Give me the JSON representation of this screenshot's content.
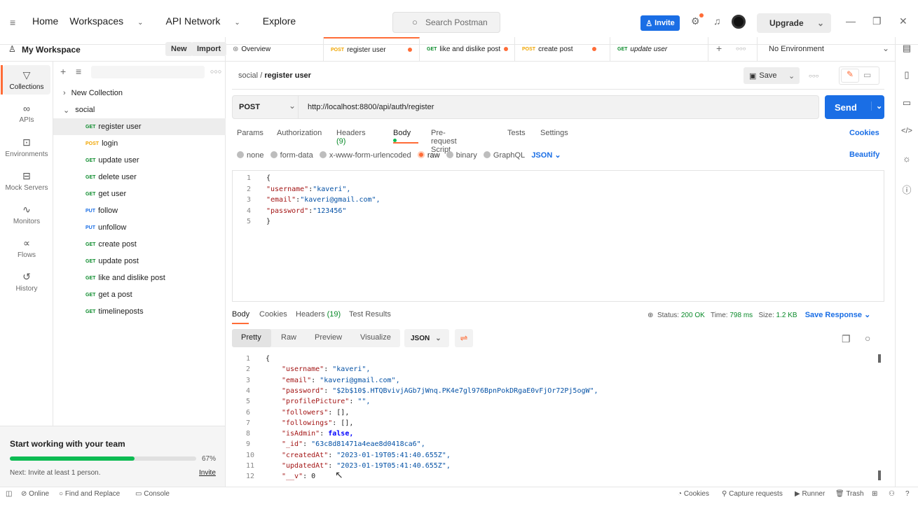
{
  "topbar": {
    "nav": [
      "Home",
      "Workspaces",
      "API Network",
      "Explore"
    ],
    "search": "Search Postman",
    "invite": "Invite",
    "upgrade": "Upgrade"
  },
  "workspace": {
    "title": "My Workspace",
    "new": "New",
    "import": "Import"
  },
  "rail": [
    "Collections",
    "APIs",
    "Environments",
    "Mock Servers",
    "Monitors",
    "Flows",
    "History"
  ],
  "tree": {
    "items": [
      {
        "label": "New Collection",
        "method": "",
        "indent": 0,
        "chevron": ">"
      },
      {
        "label": "social",
        "method": "",
        "indent": 0,
        "chevron": "v"
      },
      {
        "label": "register user",
        "method": "GET",
        "indent": 2
      },
      {
        "label": "login",
        "method": "POST",
        "indent": 2
      },
      {
        "label": "update user",
        "method": "GET",
        "indent": 2
      },
      {
        "label": "delete user",
        "method": "GET",
        "indent": 2
      },
      {
        "label": "get user",
        "method": "GET",
        "indent": 2
      },
      {
        "label": "follow",
        "method": "PUT",
        "indent": 2
      },
      {
        "label": "unfollow",
        "method": "PUT",
        "indent": 2
      },
      {
        "label": "create post",
        "method": "GET",
        "indent": 2
      },
      {
        "label": "update post",
        "method": "GET",
        "indent": 2
      },
      {
        "label": "like and dislike post",
        "method": "GET",
        "indent": 2
      },
      {
        "label": "get a post",
        "method": "GET",
        "indent": 2
      },
      {
        "label": "timelineposts",
        "method": "GET",
        "indent": 2
      }
    ]
  },
  "team": {
    "title": "Start working with your team",
    "progress_label": "67%",
    "progress": 0.67,
    "next": "Next: Invite at least 1 person.",
    "invite": "Invite"
  },
  "tabs": [
    {
      "label": "Overview",
      "method": ""
    },
    {
      "label": "register user",
      "method": "POST"
    },
    {
      "label": "like and dislike post",
      "method": "GET"
    },
    {
      "label": "create post",
      "method": "POST"
    },
    {
      "label": "update user",
      "method": "GET"
    }
  ],
  "environment": "No Environment",
  "request": {
    "collection": "social",
    "sep": "/",
    "name": "register user",
    "save": "Save",
    "method": "POST",
    "url": "http://localhost:8800/api/auth/register",
    "send": "Send"
  },
  "req_tabs": [
    "Params",
    "Authorization",
    "Headers",
    "(9)",
    "Body",
    "Pre-request Script",
    "Tests",
    "Settings"
  ],
  "cookies": "Cookies",
  "body_types": [
    "none",
    "form-data",
    "x-www-form-urlencoded",
    "raw",
    "binary",
    "GraphQL"
  ],
  "format": "JSON",
  "beautify": "Beautify",
  "req_body": [
    {
      "n": "1",
      "t": "{"
    },
    {
      "n": "2",
      "k": "\"username\"",
      "v": "\"kaveri\","
    },
    {
      "n": "3",
      "k": "\"email\"",
      "v": "\"kaveri@gmail.com\","
    },
    {
      "n": "4",
      "k": "\"password\"",
      "v": "\"123456\""
    },
    {
      "n": "5",
      "t": "}"
    }
  ],
  "resp_tabs": [
    "Body",
    "Cookies",
    "Headers",
    "(19)",
    "Test Results"
  ],
  "status": {
    "label": "Status:",
    "status": "200 OK",
    "time_label": "Time:",
    "time": "798 ms",
    "size_label": "Size:",
    "size": "1.2 KB",
    "save": "Save Response"
  },
  "resp_views": [
    "Pretty",
    "Raw",
    "Preview",
    "Visualize"
  ],
  "resp_body": [
    {
      "n": "1",
      "t": "{"
    },
    {
      "n": "2",
      "k": "\"username\"",
      "v": "\"kaveri\","
    },
    {
      "n": "3",
      "k": "\"email\"",
      "v": "\"kaveri@gmail.com\","
    },
    {
      "n": "4",
      "k": "\"password\"",
      "v": "\"$2b$10$.HTQBvivjAGb7jWnq.PK4e7gl976BpnPokDRgaE0vFjOr72Pj5ogW\","
    },
    {
      "n": "5",
      "k": "\"profilePicture\"",
      "v": "\"\","
    },
    {
      "n": "6",
      "k": "\"followers\"",
      "v": "[],"
    },
    {
      "n": "7",
      "k": "\"followings\"",
      "v": "[],"
    },
    {
      "n": "8",
      "k": "\"isAdmin\"",
      "v": "false,"
    },
    {
      "n": "9",
      "k": "\"_id\"",
      "v": "\"63c8d81471a4eae8d0418ca6\","
    },
    {
      "n": "10",
      "k": "\"createdAt\"",
      "v": "\"2023-01-19T05:41:40.655Z\","
    },
    {
      "n": "11",
      "k": "\"updatedAt\"",
      "v": "\"2023-01-19T05:41:40.655Z\","
    },
    {
      "n": "12",
      "k": "\"__v\"",
      "v": "0"
    }
  ],
  "bottom": {
    "online": "Online",
    "find": "Find and Replace",
    "console": "Console",
    "cookies": "Cookies",
    "capture": "Capture requests",
    "runner": "Runner",
    "trash": "Trash"
  }
}
